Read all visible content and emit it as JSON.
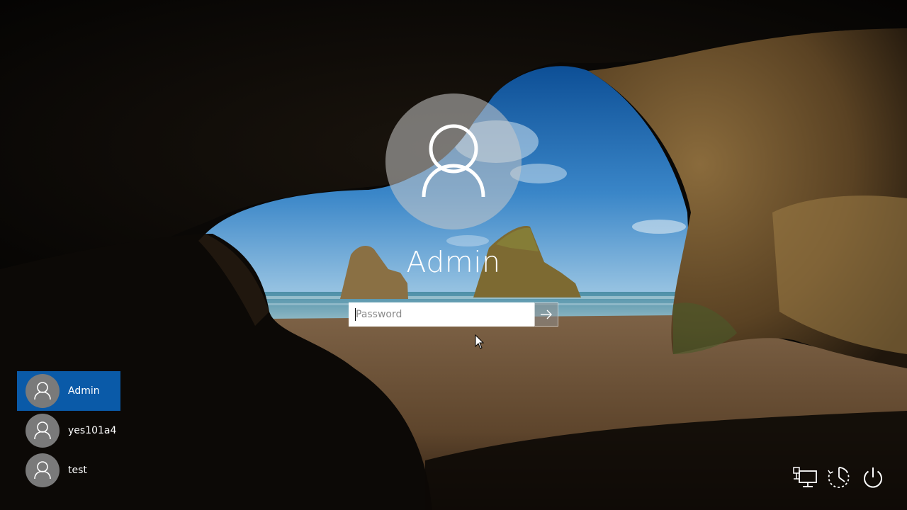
{
  "login": {
    "current_user": "Admin",
    "password_placeholder": "Password",
    "password_value": ""
  },
  "users": [
    {
      "name": "Admin",
      "selected": true
    },
    {
      "name": "yes101a4",
      "selected": false
    },
    {
      "name": "test",
      "selected": false
    }
  ],
  "system_icons": {
    "network": "network-icon",
    "ease_of_access": "ease-of-access-icon",
    "power": "power-icon"
  },
  "colors": {
    "selected_user_bg": "#0a5aa8",
    "text": "#ffffff"
  }
}
